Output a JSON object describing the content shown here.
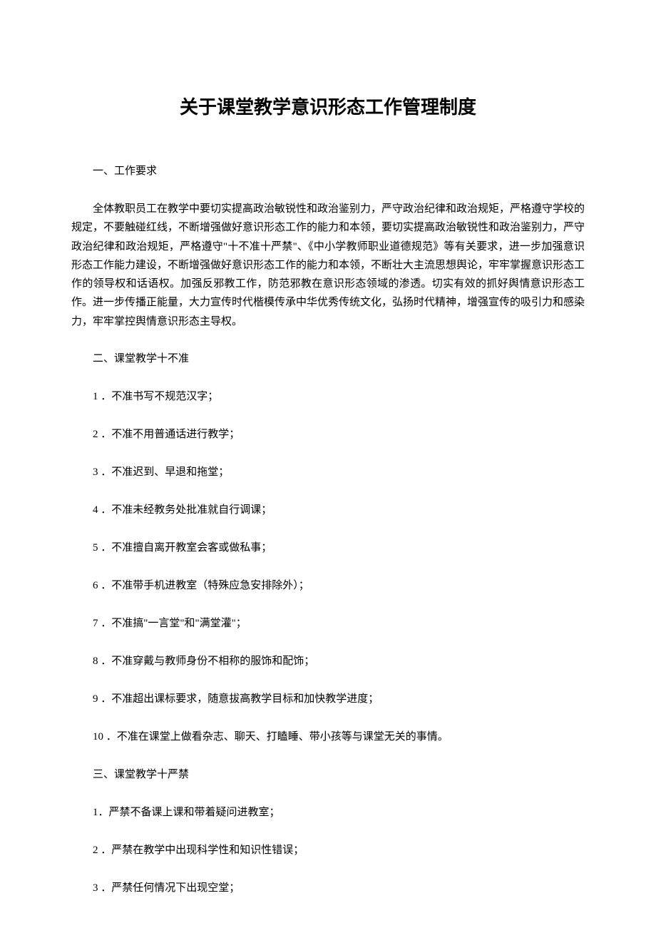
{
  "title": "关于课堂教学意识形态工作管理制度",
  "section1": {
    "heading": "一、工作要求",
    "paragraph": "全体教职员工在教学中要切实提高政治敏锐性和政治鉴别力，严守政治纪律和政治规矩，严格遵守学校的规定，不要触碰红线，不断增强做好意识形态工作的能力和本领，要切实提高政治敏锐性和政治鉴别力，严守政治纪律和政治规矩，严格遵守\"十不准十严禁\"、《中小学教师职业道德规范》等有关要求，进一步加强意识形态工作能力建设，不断增强做好意识形态工作的能力和本领，不断壮大主流思想舆论，牢牢掌握意识形态工作的领导权和话语权。加强反邪教工作，防范邪教在意识形态领域的渗透。切实有效的抓好舆情意识形态工作。进一步传播正能量，大力宣传时代楷模传承中华优秀传统文化，弘扬时代精神，增强宣传的吸引力和感染力，牢牢掌控舆情意识形态主导权。"
  },
  "section2": {
    "heading": "二、课堂教学十不准",
    "items": [
      "1 ．不准书写不规范汉字；",
      "2 ．不准不用普通话进行教学；",
      "3 ．不准迟到、早退和拖堂；",
      "4 ．不准未经教务处批准就自行调课；",
      "5 ．不准擅自离开教室会客或做私事；",
      "6 ．不准带手机进教室（特殊应急安排除外）；",
      "7 ．不准搞\"一言堂\"和\"满堂灌\"；",
      "8 ．不准穿戴与教师身份不相称的服饰和配饰；",
      "9 ．不准超出课标要求，随意拔高教学目标和加快教学进度；",
      "10 ．不准在课堂上做看杂志、聊天、打瞌睡、带小孩等与课堂无关的事情。"
    ]
  },
  "section3": {
    "heading": "三、课堂教学十严禁",
    "items": [
      "1．严禁不备课上课和带着疑问进教室；",
      "2 ．严禁在教学中出现科学性和知识性错误；",
      "3 ．严禁任何情况下出现空堂；"
    ]
  }
}
